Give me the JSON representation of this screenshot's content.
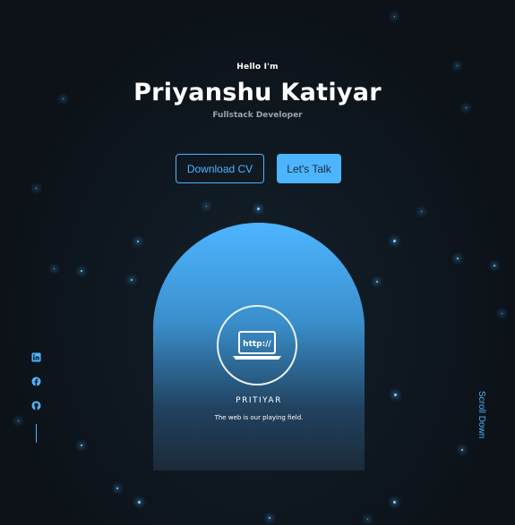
{
  "hero": {
    "greeting": "Hello I'm",
    "name": "Priyanshu Katiyar",
    "role": "Fullstack Developer"
  },
  "buttons": {
    "download_cv": "Download CV",
    "lets_talk": "Let's Talk"
  },
  "logo": {
    "screen_text": "http://",
    "brand": "PRITIYAR",
    "tagline": "The web is our playing field."
  },
  "socials": {
    "icons": [
      "linkedin-icon",
      "facebook-icon",
      "github-icon"
    ]
  },
  "scroll": {
    "label": "Scroll Down"
  },
  "colors": {
    "accent": "#4db5ff",
    "background": "#0c1218",
    "text": "#ffffff",
    "muted": "#9aa3ab"
  }
}
